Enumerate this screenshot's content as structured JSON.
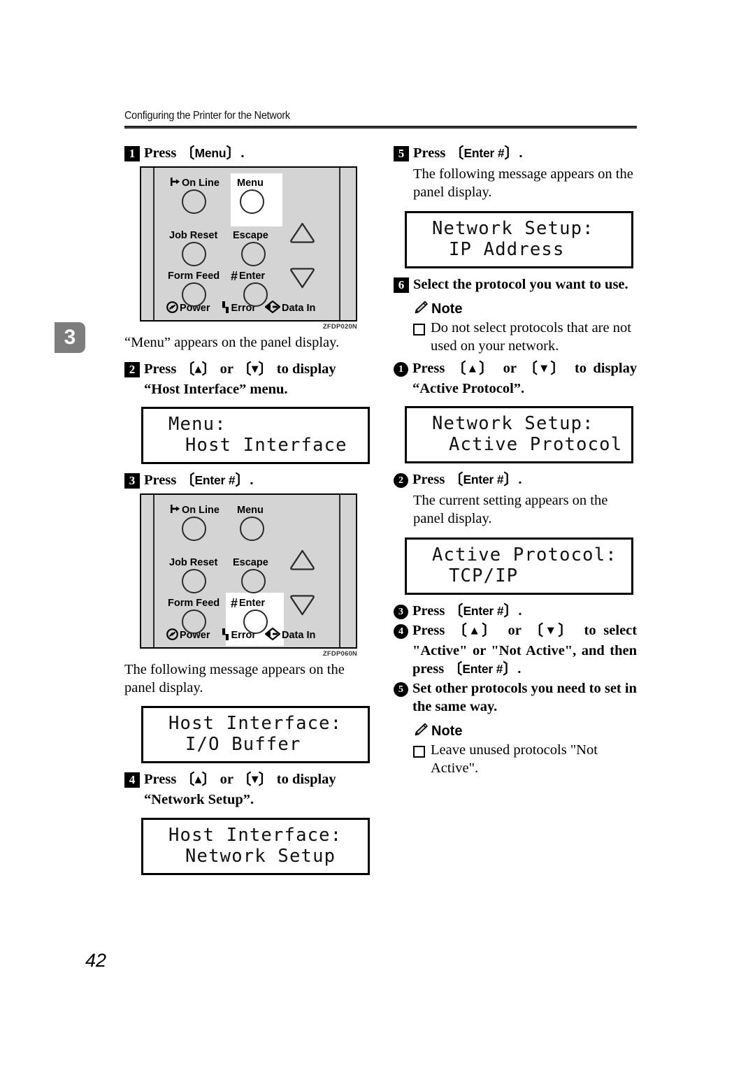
{
  "header": {
    "running_head": "Configuring the Printer for the Network"
  },
  "chapter_tab": "3",
  "page_number": "42",
  "panel_figure": {
    "buttons": [
      {
        "label": "On Line",
        "icon": "online-arrow-icon"
      },
      {
        "label": "Menu",
        "icon": null
      },
      {
        "label": "Job Reset",
        "icon": null
      },
      {
        "label": "Escape",
        "icon": null
      },
      {
        "label": "Form Feed",
        "icon": null
      },
      {
        "label": "Enter",
        "icon": "hash-icon"
      }
    ],
    "arrow_keys": [
      "up-triangle-icon",
      "down-triangle-icon"
    ],
    "indicators": [
      {
        "label": "Power",
        "icon": "power-icon"
      },
      {
        "label": "Error",
        "icon": "error-bolt-icon"
      },
      {
        "label": "Data In",
        "icon": "data-in-icon"
      }
    ],
    "caption_1": "ZFDP020N",
    "caption_2": "ZFDP060N",
    "highlighted_1": "Menu",
    "highlighted_2": "Enter"
  },
  "left_column": {
    "step1": {
      "num": "1",
      "press_word": "Press",
      "key": "Menu",
      "period": ".",
      "after_figure_text": "“Menu” appears on the panel display."
    },
    "step2": {
      "num": "2",
      "text_a": "Press",
      "key_up": "▲",
      "or_word": "or",
      "key_down": "▼",
      "text_b": "to display “Host Interface” menu.",
      "lcd": {
        "line1": "Menu:",
        "line2": "Host Interface"
      }
    },
    "step3": {
      "num": "3",
      "press_word": "Press",
      "key": "Enter #",
      "period": ".",
      "after_figure_text": "The following message appears on the panel display.",
      "lcd": {
        "line1": "Host Interface:",
        "line2": "I/O Buffer"
      }
    },
    "step4": {
      "num": "4",
      "text_a": "Press",
      "key_up": "▲",
      "or_word": "or",
      "key_down": "▼",
      "text_b": "to display “Network Setup”.",
      "lcd": {
        "line1": "Host Interface:",
        "line2": "Network Setup"
      }
    }
  },
  "right_column": {
    "step5": {
      "num": "5",
      "press_word": "Press",
      "key": "Enter #",
      "period": ".",
      "body": "The following message appears on the panel display.",
      "lcd": {
        "line1": "Network Setup:",
        "line2": "IP Address"
      }
    },
    "step6": {
      "num": "6",
      "title": "Select the protocol you want to use.",
      "note_label": "Note",
      "note_item": "Do not select protocols that are not used on your network.",
      "sub1": {
        "num": "1",
        "text_a": "Press",
        "key_up": "▲",
        "or_word": "or",
        "key_down": "▼",
        "text_b": "to display “Active Protocol”.",
        "lcd": {
          "line1": "Network Setup:",
          "line2": "Active Protocol"
        }
      },
      "sub2": {
        "num": "2",
        "press_word": "Press",
        "key": "Enter #",
        "period": ".",
        "body": "The current setting appears on the panel display.",
        "lcd": {
          "line1": "Active Protocol:",
          "line2": "TCP/IP"
        }
      },
      "sub3": {
        "num": "3",
        "press_word": "Press",
        "key": "Enter #",
        "period": "."
      },
      "sub4": {
        "num": "4",
        "text_a": "Press",
        "key_up": "▲",
        "or_word": "or",
        "key_down": "▼",
        "text_b": "to select \"Active\" or \"Not Active\", and then press",
        "key_enter": "Enter #",
        "period": "."
      },
      "sub5": {
        "num": "5",
        "title": "Set other protocols you need to set in the same way.",
        "note_label": "Note",
        "note_item": "Leave unused protocols \"Not Active\"."
      }
    }
  }
}
